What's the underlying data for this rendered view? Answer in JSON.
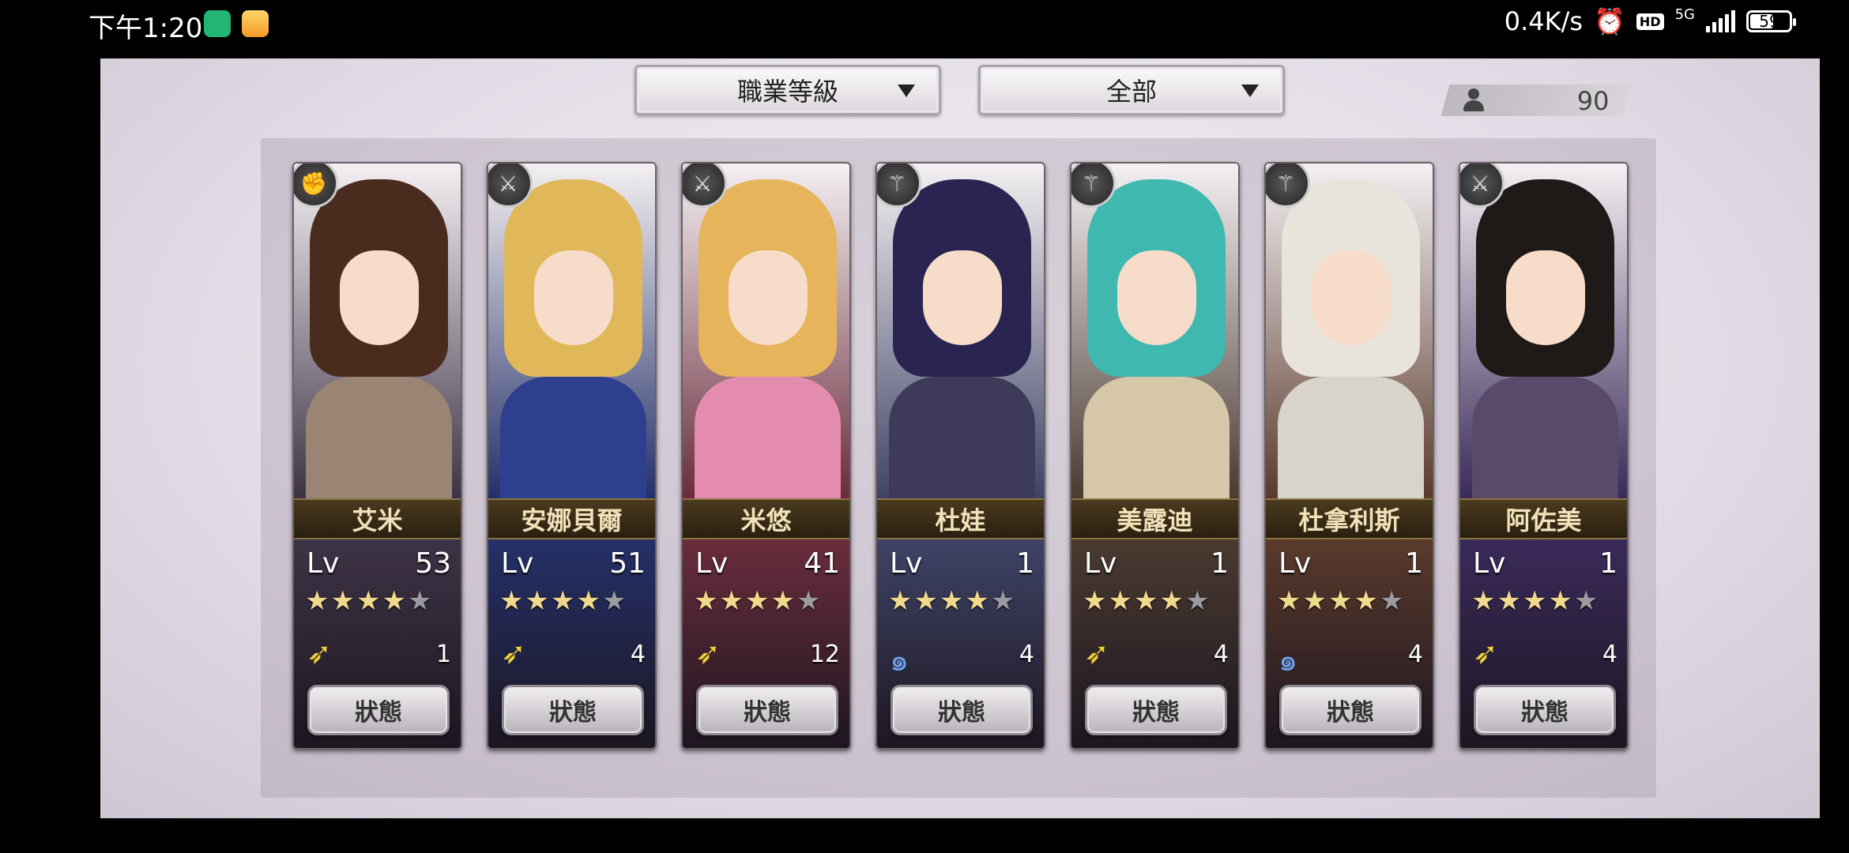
{
  "statusbar": {
    "time": "下午1:20",
    "network_speed": "0.4K/s",
    "hd_label": "HD",
    "network_type": "5G",
    "battery": "59",
    "app_icons": [
      "shield-app-icon",
      "chat-app-icon"
    ]
  },
  "toolbar": {
    "sort_label": "職業等級",
    "filter_label": "全部",
    "unit_count": "90"
  },
  "characters": [
    {
      "name": "艾米",
      "lv_label": "Lv",
      "level": "53",
      "stars": 4,
      "max_stars": 5,
      "element_icon": "wind-icon",
      "element_value": "1",
      "status_label": "狀態",
      "class_icon": "gauntlet-icon",
      "colors": {
        "hair": "#4a2c1f",
        "body": "#9a8474",
        "bg": "#3d3346"
      }
    },
    {
      "name": "安娜貝爾",
      "lv_label": "Lv",
      "level": "51",
      "stars": 4,
      "max_stars": 5,
      "element_icon": "wind-icon",
      "element_value": "4",
      "status_label": "狀態",
      "class_icon": "sword-icon",
      "colors": {
        "hair": "#e0b85a",
        "body": "#2f3f8f",
        "bg": "#243068"
      }
    },
    {
      "name": "米悠",
      "lv_label": "Lv",
      "level": "41",
      "stars": 4,
      "max_stars": 5,
      "element_icon": "wind-icon",
      "element_value": "12",
      "status_label": "狀態",
      "class_icon": "sword-icon",
      "colors": {
        "hair": "#e6b45b",
        "body": "#e48cae",
        "bg": "#6a2c3c"
      }
    },
    {
      "name": "杜娃",
      "lv_label": "Lv",
      "level": "1",
      "stars": 4,
      "max_stars": 5,
      "element_icon": "water-swirl-icon",
      "element_value": "4",
      "status_label": "狀態",
      "class_icon": "staff-icon",
      "colors": {
        "hair": "#2a2550",
        "body": "#3e3a5a",
        "bg": "#3e4366"
      }
    },
    {
      "name": "美露迪",
      "lv_label": "Lv",
      "level": "1",
      "stars": 4,
      "max_stars": 5,
      "element_icon": "wind-icon",
      "element_value": "4",
      "status_label": "狀態",
      "class_icon": "staff-icon",
      "colors": {
        "hair": "#3fb8b0",
        "body": "#d6c7a9",
        "bg": "#4a3a30"
      }
    },
    {
      "name": "杜拿利斯",
      "lv_label": "Lv",
      "level": "1",
      "stars": 4,
      "max_stars": 5,
      "element_icon": "water-swirl-icon",
      "element_value": "4",
      "status_label": "狀態",
      "class_icon": "staff-icon",
      "colors": {
        "hair": "#e8e4dc",
        "body": "#d8d4cc",
        "bg": "#5a3a2c"
      }
    },
    {
      "name": "阿佐美",
      "lv_label": "Lv",
      "level": "1",
      "stars": 4,
      "max_stars": 5,
      "element_icon": "wind-icon",
      "element_value": "4",
      "status_label": "狀態",
      "class_icon": "sword-icon",
      "colors": {
        "hair": "#1f1a18",
        "body": "#5a4a6a",
        "bg": "#3a2a5a"
      }
    }
  ]
}
